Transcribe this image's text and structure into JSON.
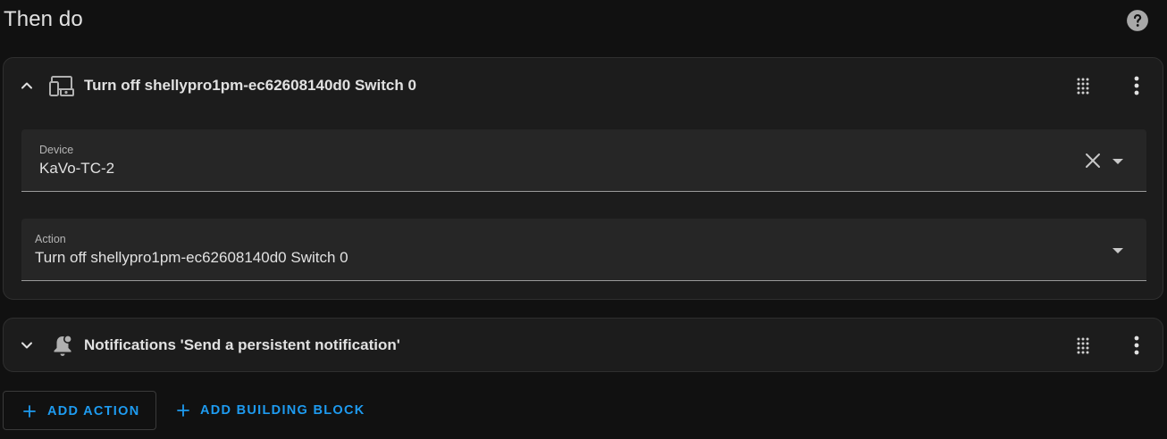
{
  "section": {
    "title": "Then do"
  },
  "icons": {
    "help": "help-circle-icon",
    "expanded_chevron": "chevron-up-icon",
    "collapsed_chevron": "chevron-down-icon",
    "device_action": "devices-icon",
    "notification": "bell-badge-icon",
    "drag": "drag-handle-icon",
    "menu": "dots-vertical-icon",
    "clear": "close-icon",
    "dropdown": "menu-down-icon",
    "add": "plus-icon"
  },
  "actions": [
    {
      "title": "Turn off shellypro1pm-ec62608140d0 Switch 0",
      "expanded": true,
      "fields": {
        "device": {
          "label": "Device",
          "value": "KaVo-TC-2"
        },
        "action": {
          "label": "Action",
          "value": "Turn off shellypro1pm-ec62608140d0 Switch 0"
        }
      }
    },
    {
      "title": "Notifications 'Send a persistent notification'",
      "expanded": false
    }
  ],
  "buttons": {
    "add_action": "ADD ACTION",
    "add_building_block": "ADD BUILDING BLOCK"
  },
  "colors": {
    "background": "#111111",
    "card": "#1c1c1c",
    "field": "#262626",
    "text": "#e1e1e1",
    "accent": "#1e9bf0",
    "icon": "#b0b0b0"
  }
}
